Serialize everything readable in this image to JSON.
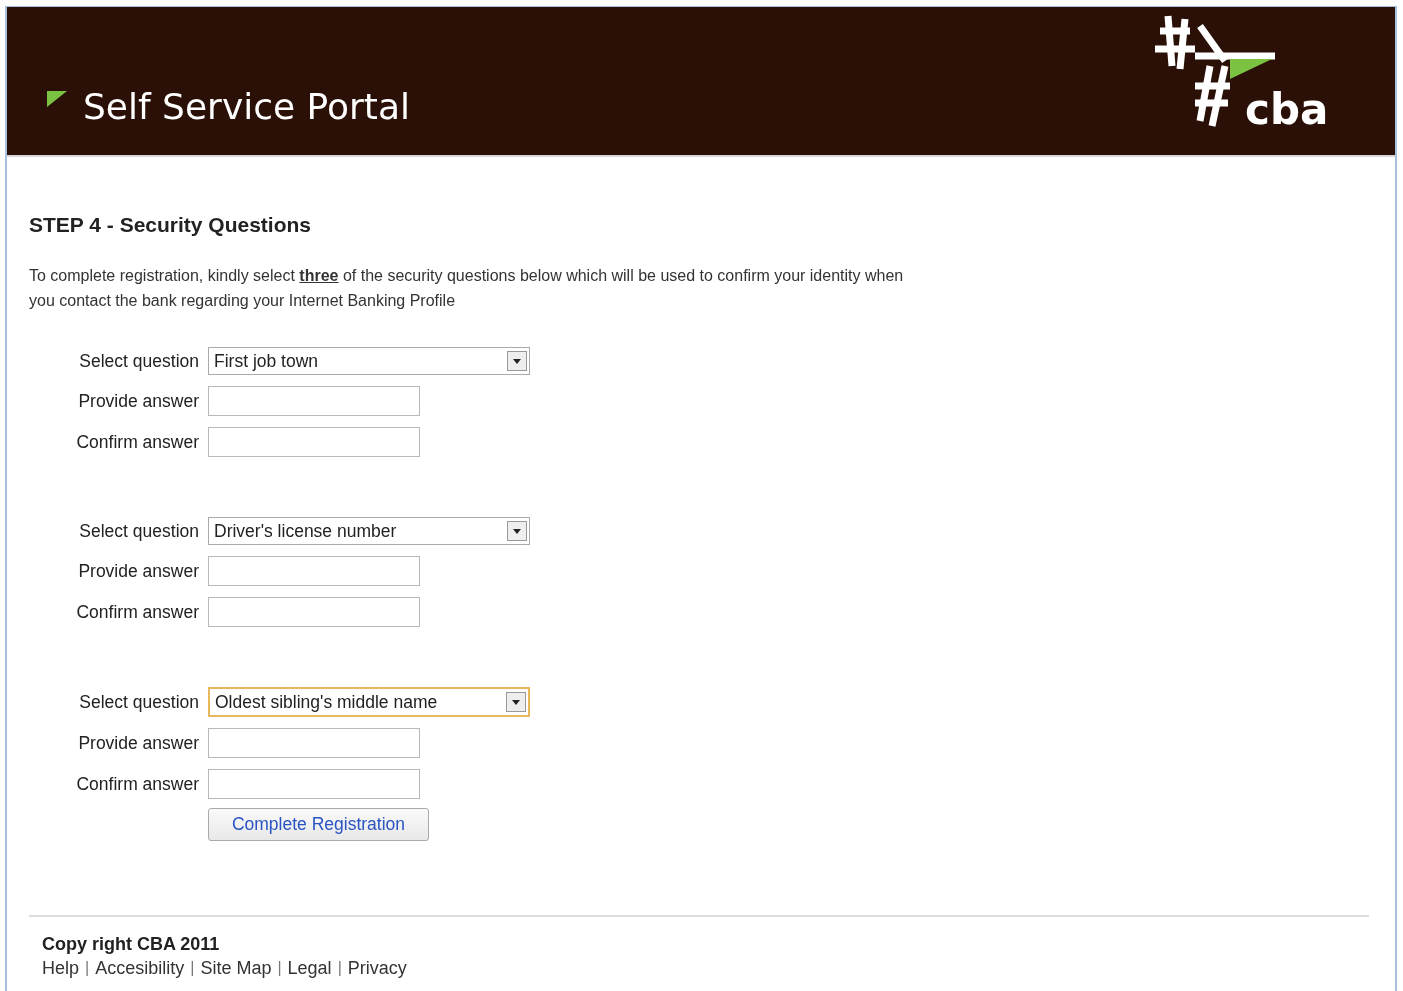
{
  "header": {
    "title": "Self Service Portal",
    "logo_text": "cba"
  },
  "heading": "STEP 4 - Security Questions",
  "intro": "To complete registration, kindly select **three** of the security questions below which will be used to confirm your identity when you contact the bank regarding your Internet Banking Profile",
  "question_groups": [
    {
      "select_label": "Select question",
      "question": "First job town",
      "focused": false,
      "answer_label": "Provide answer",
      "confirm_label": "Confirm answer"
    },
    {
      "select_label": "Select question",
      "question": "Driver's license number",
      "focused": false,
      "answer_label": "Provide answer",
      "confirm_label": "Confirm answer"
    },
    {
      "select_label": "Select question",
      "question": "Oldest sibling's middle name",
      "focused": true,
      "answer_label": "Provide answer",
      "confirm_label": "Confirm answer"
    }
  ],
  "submit_button": "Complete Registration",
  "footer": {
    "copyright": "Copy right CBA 2011",
    "links": [
      {
        "kind": "link",
        "text": "Help"
      },
      {
        "kind": "separator",
        "text": "|"
      },
      {
        "kind": "link",
        "text": "Accesibility"
      },
      {
        "kind": "separator",
        "text": "|"
      },
      {
        "kind": "link",
        "text": "Site Map"
      },
      {
        "kind": "separator",
        "text": "|"
      },
      {
        "kind": "link",
        "text": "Legal"
      },
      {
        "kind": "separator",
        "text": "|"
      },
      {
        "kind": "link",
        "text": "Privacy"
      }
    ]
  }
}
